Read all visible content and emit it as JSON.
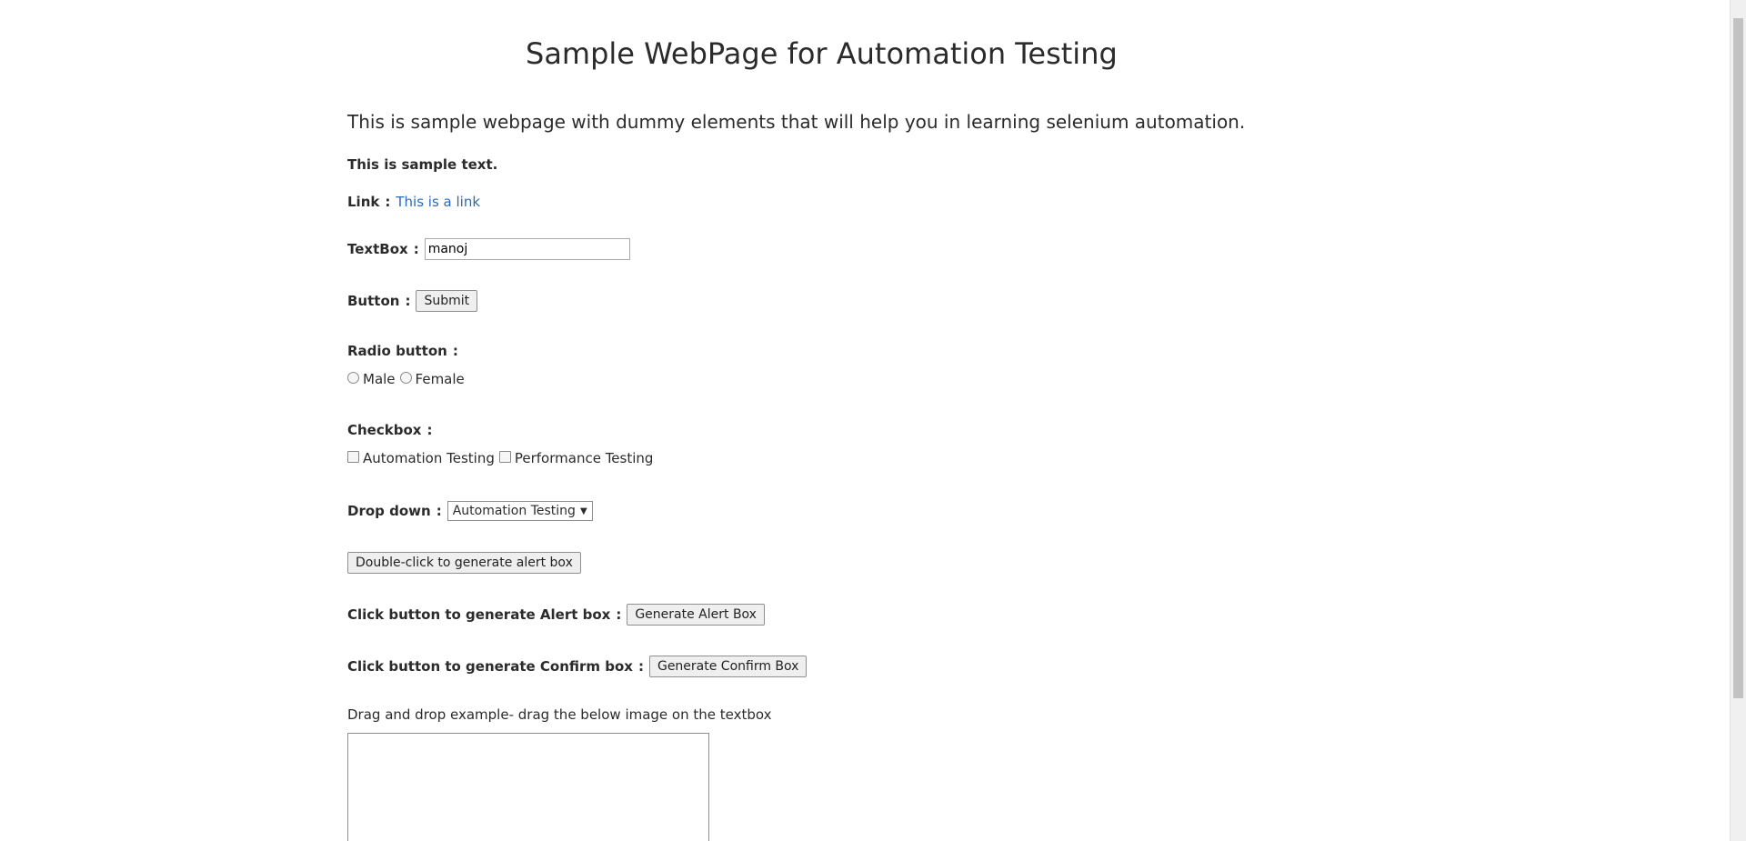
{
  "heading": "Sample WebPage for Automation Testing",
  "intro": "This is sample webpage with dummy elements that will help you in learning selenium automation.",
  "sample_text": "This is sample text.",
  "link_row": {
    "label": "Link",
    "colon": ":",
    "link_text": "This is a link"
  },
  "textbox_row": {
    "label": "TextBox",
    "colon": ":",
    "value": "manoj"
  },
  "button_row": {
    "label": "Button",
    "colon": ":",
    "button_text": "Submit"
  },
  "radio_row": {
    "label": "Radio button",
    "colon": ":",
    "options": [
      "Male",
      "Female"
    ]
  },
  "checkbox_row": {
    "label": "Checkbox",
    "colon": ":",
    "options": [
      "Automation Testing",
      "Performance Testing"
    ]
  },
  "dropdown_row": {
    "label": "Drop down",
    "colon": ":",
    "selected": "Automation Testing",
    "caret": "▼"
  },
  "dblclick_button": "Double-click to generate alert box",
  "alert_row": {
    "label": "Click button to generate Alert box",
    "colon": ":",
    "button_text": "Generate Alert Box"
  },
  "confirm_row": {
    "label": "Click button to generate Confirm box",
    "colon": ":",
    "button_text": "Generate Confirm Box"
  },
  "drag_text": "Drag and drop example- drag the below image on the textbox"
}
